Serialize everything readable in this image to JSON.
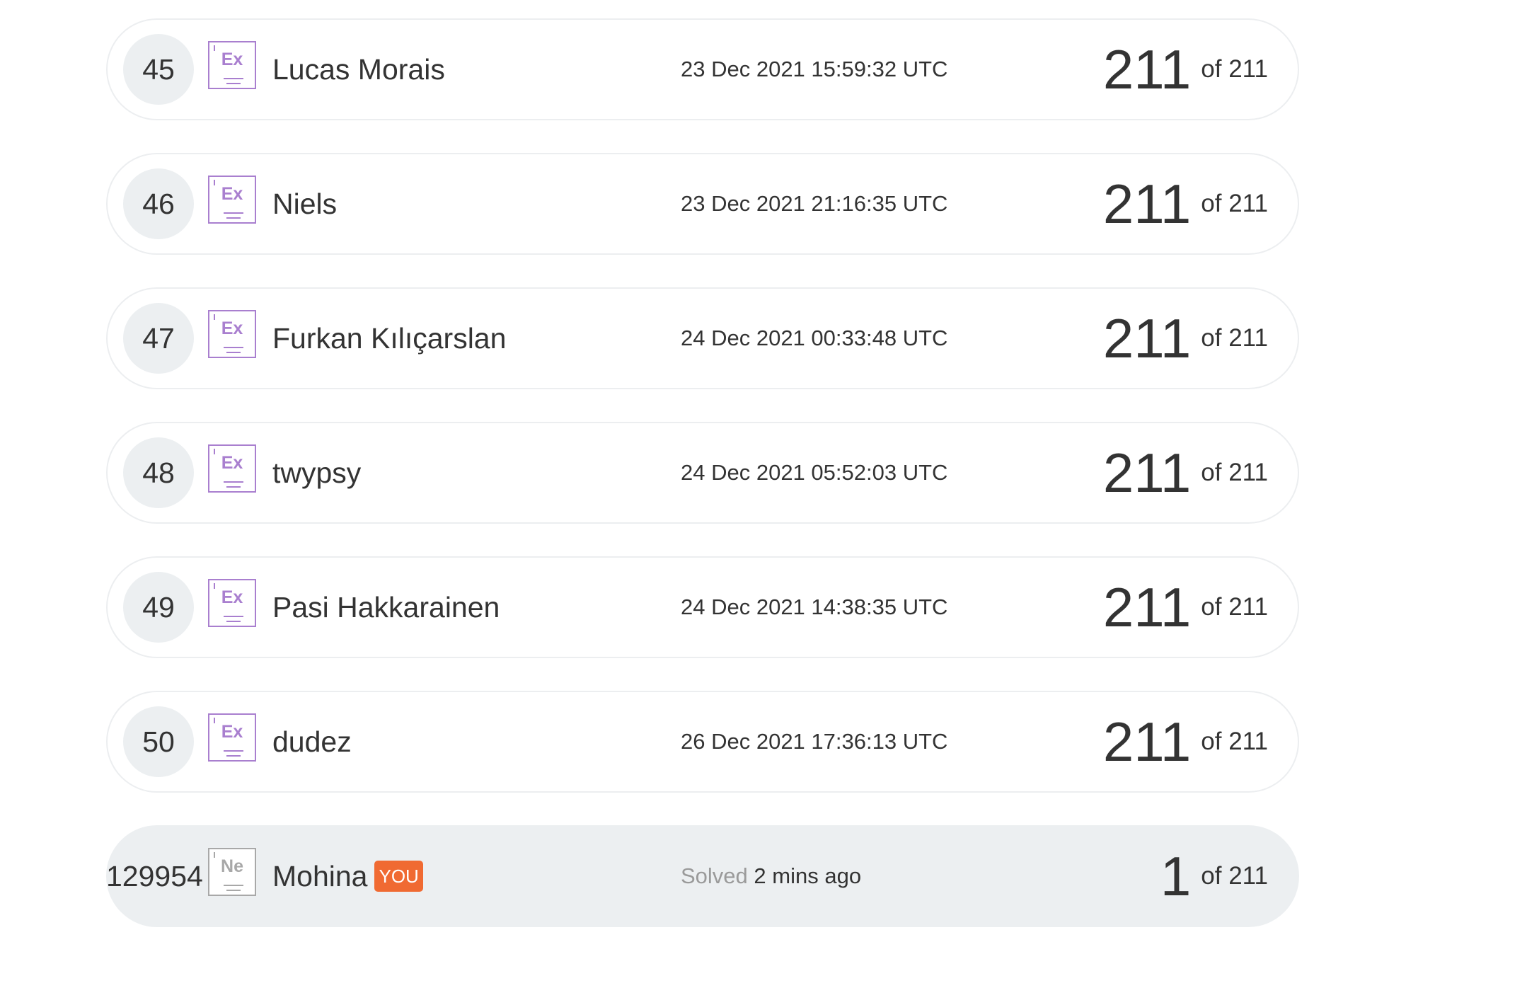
{
  "rows": [
    {
      "rank": "45",
      "element": "Ex",
      "name": "Lucas Morais",
      "date": "23 Dec 2021 15:59:32 UTC",
      "score": "211",
      "total": "of 211"
    },
    {
      "rank": "46",
      "element": "Ex",
      "name": "Niels",
      "date": "23 Dec 2021 21:16:35 UTC",
      "score": "211",
      "total": "of 211"
    },
    {
      "rank": "47",
      "element": "Ex",
      "name": "Furkan Kılıçarslan",
      "date": "24 Dec 2021 00:33:48 UTC",
      "score": "211",
      "total": "of 211"
    },
    {
      "rank": "48",
      "element": "Ex",
      "name": "twypsy",
      "date": "24 Dec 2021 05:52:03 UTC",
      "score": "211",
      "total": "of 211"
    },
    {
      "rank": "49",
      "element": "Ex",
      "name": "Pasi Hakkarainen",
      "date": "24 Dec 2021 14:38:35 UTC",
      "score": "211",
      "total": "of 211"
    },
    {
      "rank": "50",
      "element": "Ex",
      "name": "dudez",
      "date": "26 Dec 2021 17:36:13 UTC",
      "score": "211",
      "total": "of 211"
    }
  ],
  "current_user": {
    "rank": "129954",
    "element": "Ne",
    "name": "Mohina",
    "badge": "YOU",
    "solved_label": "Solved",
    "solved_time": "2 mins ago",
    "score": "1",
    "total": "of 211"
  },
  "colors": {
    "element_purple": "#a97fcf",
    "element_grey": "#a8a8a8",
    "you_badge": "#f06a32",
    "current_row_bg": "#eceff1",
    "rank_circle_bg": "#eceff1"
  }
}
